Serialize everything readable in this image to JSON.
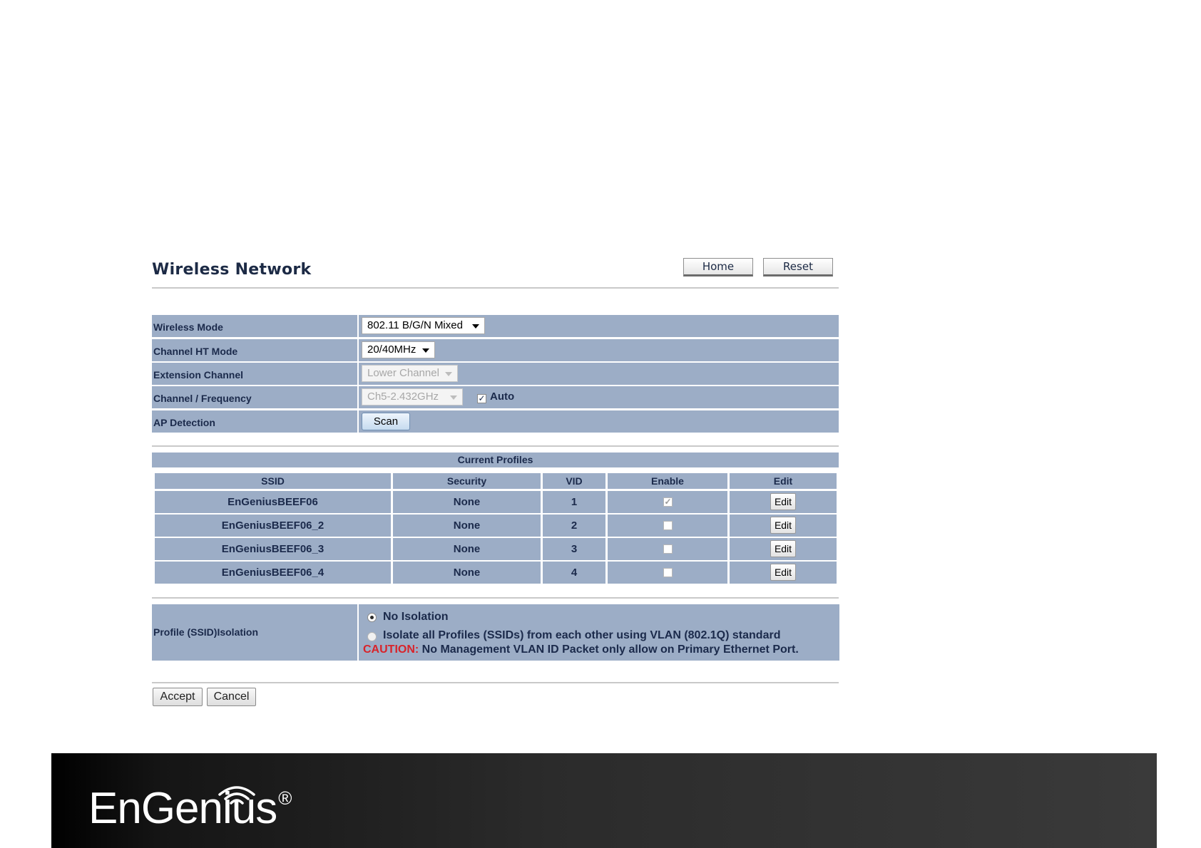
{
  "header": {
    "title": "Wireless Network",
    "home_label": "Home",
    "reset_label": "Reset"
  },
  "settings": {
    "wireless_mode": {
      "label": "Wireless Mode",
      "value": "802.11 B/G/N Mixed"
    },
    "channel_ht_mode": {
      "label": "Channel HT Mode",
      "value": "20/40MHz"
    },
    "extension_channel": {
      "label": "Extension Channel",
      "value": "Lower Channel",
      "disabled": true
    },
    "channel_frequency": {
      "label": "Channel / Frequency",
      "value": "Ch5-2.432GHz",
      "disabled": true,
      "auto_label": "Auto",
      "auto_checked": true
    },
    "ap_detection": {
      "label": "AP Detection",
      "scan_label": "Scan"
    }
  },
  "profiles": {
    "title": "Current Profiles",
    "columns": [
      "SSID",
      "Security",
      "VID",
      "Enable",
      "Edit"
    ],
    "rows": [
      {
        "ssid": "EnGeniusBEEF06",
        "security": "None",
        "vid": "1",
        "enabled": true,
        "edit": "Edit"
      },
      {
        "ssid": "EnGeniusBEEF06_2",
        "security": "None",
        "vid": "2",
        "enabled": false,
        "edit": "Edit"
      },
      {
        "ssid": "EnGeniusBEEF06_3",
        "security": "None",
        "vid": "3",
        "enabled": false,
        "edit": "Edit"
      },
      {
        "ssid": "EnGeniusBEEF06_4",
        "security": "None",
        "vid": "4",
        "enabled": false,
        "edit": "Edit"
      }
    ]
  },
  "isolation": {
    "label": "Profile (SSID)Isolation",
    "option_none": "No Isolation",
    "option_vlan": "Isolate all Profiles (SSIDs) from each other using VLAN (802.1Q) standard",
    "selected": "none",
    "caution_label": "CAUTION:",
    "caution_text": " No Management VLAN ID Packet only allow on Primary Ethernet Port."
  },
  "actions": {
    "accept_label": "Accept",
    "cancel_label": "Cancel"
  },
  "footer": {
    "brand": "EnGenius",
    "registered": "®"
  },
  "colors": {
    "table_bg": "#9cadc6",
    "text": "#1b2a4b",
    "caution": "#d8232a",
    "footer_bg": "#2b2b2b"
  }
}
